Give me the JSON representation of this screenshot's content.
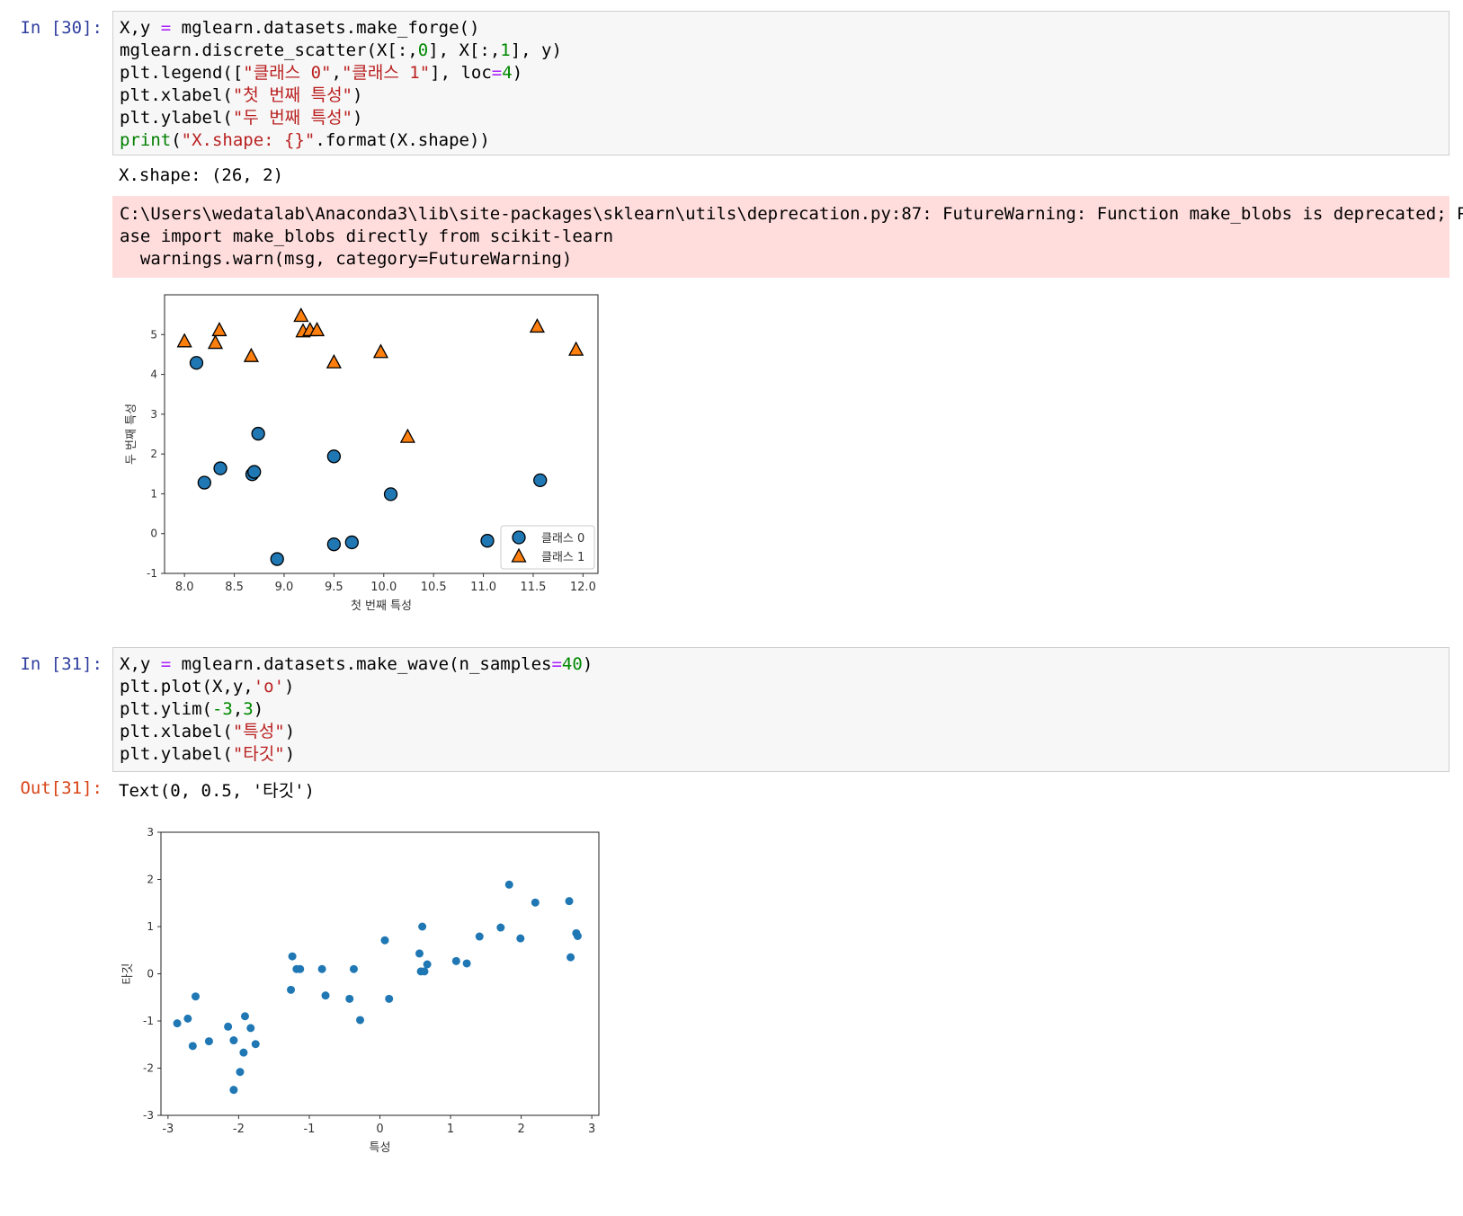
{
  "cells": [
    {
      "prompt": "In [30]:",
      "code": [
        [
          {
            "t": "X,y "
          },
          {
            "t": "=",
            "c": "op"
          },
          {
            "t": " mglearn.datasets.make_forge()"
          }
        ],
        [
          {
            "t": "mglearn.discrete_scatter(X[:,"
          },
          {
            "t": "0",
            "c": "num"
          },
          {
            "t": "], X[:,"
          },
          {
            "t": "1",
            "c": "num"
          },
          {
            "t": "], y)"
          }
        ],
        [
          {
            "t": "plt.legend(["
          },
          {
            "t": "\"클래스 0\"",
            "c": "str"
          },
          {
            "t": ","
          },
          {
            "t": "\"클래스 1\"",
            "c": "str"
          },
          {
            "t": "], loc"
          },
          {
            "t": "=",
            "c": "op"
          },
          {
            "t": "4",
            "c": "num"
          },
          {
            "t": ")"
          }
        ],
        [
          {
            "t": "plt.xlabel("
          },
          {
            "t": "\"첫 번째 특성\"",
            "c": "str"
          },
          {
            "t": ")"
          }
        ],
        [
          {
            "t": "plt.ylabel("
          },
          {
            "t": "\"두 번째 특성\"",
            "c": "str"
          },
          {
            "t": ")"
          }
        ],
        [
          {
            "t": "print",
            "c": "bi"
          },
          {
            "t": "("
          },
          {
            "t": "\"X.shape: {}\"",
            "c": "str"
          },
          {
            "t": ".format(X.shape))"
          }
        ]
      ],
      "stdout": "X.shape: (26, 2)",
      "stderr": [
        "C:\\Users\\wedatalab\\Anaconda3\\lib\\site-packages\\sklearn\\utils\\deprecation.py:87: FutureWarning: Function make_blobs is deprecated; Ple",
        "ase import make_blobs directly from scikit-learn",
        "  warnings.warn(msg, category=FutureWarning)"
      ]
    },
    {
      "prompt": "In [31]:",
      "code": [
        [
          {
            "t": "X,y "
          },
          {
            "t": "=",
            "c": "op"
          },
          {
            "t": " mglearn.datasets.make_wave(n_samples"
          },
          {
            "t": "=",
            "c": "op"
          },
          {
            "t": "40",
            "c": "num"
          },
          {
            "t": ")"
          }
        ],
        [
          {
            "t": "plt.plot(X,y,"
          },
          {
            "t": "'o'",
            "c": "str"
          },
          {
            "t": ")"
          }
        ],
        [
          {
            "t": "plt.ylim("
          },
          {
            "t": "-3",
            "c": "num"
          },
          {
            "t": ","
          },
          {
            "t": "3",
            "c": "num"
          },
          {
            "t": ")"
          }
        ],
        [
          {
            "t": "plt.xlabel("
          },
          {
            "t": "\"특성\"",
            "c": "str"
          },
          {
            "t": ")"
          }
        ],
        [
          {
            "t": "plt.ylabel("
          },
          {
            "t": "\"타깃\"",
            "c": "str"
          },
          {
            "t": ")"
          }
        ]
      ],
      "out_prompt": "Out[31]:",
      "out_text": "Text(0, 0.5, '타깃')"
    }
  ],
  "colors": {
    "class0": "#1f77b4",
    "class1": "#ff7f0e",
    "wave": "#1f77b4"
  },
  "chart_data": [
    {
      "type": "scatter",
      "xlabel": "첫 번째 특성",
      "ylabel": "두 번째 특성",
      "xlim": [
        7.8,
        12.15
      ],
      "ylim": [
        -1,
        6
      ],
      "xticks": [
        "8.0",
        "8.5",
        "9.0",
        "9.5",
        "10.0",
        "10.5",
        "11.0",
        "11.5",
        "12.0"
      ],
      "xtick_values": [
        8.0,
        8.5,
        9.0,
        9.5,
        10.0,
        10.5,
        11.0,
        11.5,
        12.0
      ],
      "yticks": [
        "-1",
        "0",
        "1",
        "2",
        "3",
        "4",
        "5"
      ],
      "ytick_values": [
        -1,
        0,
        1,
        2,
        3,
        4,
        5
      ],
      "legend_position": "lower-right",
      "series": [
        {
          "name": "클래스 0",
          "marker": "circle",
          "points": [
            [
              8.12,
              4.29
            ],
            [
              8.2,
              1.28
            ],
            [
              8.36,
              1.64
            ],
            [
              8.68,
              1.49
            ],
            [
              8.7,
              1.55
            ],
            [
              8.74,
              2.51
            ],
            [
              8.93,
              -0.64
            ],
            [
              9.5,
              1.94
            ],
            [
              9.5,
              -0.27
            ],
            [
              9.68,
              -0.22
            ],
            [
              10.07,
              0.99
            ],
            [
              11.04,
              -0.18
            ],
            [
              11.57,
              1.34
            ]
          ]
        },
        {
          "name": "클래스 1",
          "marker": "triangle",
          "points": [
            [
              8.0,
              4.83
            ],
            [
              8.31,
              4.79
            ],
            [
              8.35,
              5.11
            ],
            [
              8.67,
              4.46
            ],
            [
              9.17,
              5.47
            ],
            [
              9.19,
              5.08
            ],
            [
              9.26,
              5.11
            ],
            [
              9.33,
              5.11
            ],
            [
              9.5,
              4.3
            ],
            [
              9.97,
              4.56
            ],
            [
              10.24,
              2.43
            ],
            [
              11.54,
              5.2
            ],
            [
              11.93,
              4.62
            ]
          ]
        }
      ]
    },
    {
      "type": "scatter",
      "xlabel": "특성",
      "ylabel": "타깃",
      "xlim": [
        -3.1,
        3.1
      ],
      "ylim": [
        -3,
        3
      ],
      "xticks": [
        "-3",
        "-2",
        "-1",
        "0",
        "1",
        "2",
        "3"
      ],
      "xtick_values": [
        -3,
        -2,
        -1,
        0,
        1,
        2,
        3
      ],
      "yticks": [
        "-3",
        "-2",
        "-1",
        "0",
        "1",
        "2",
        "3"
      ],
      "ytick_values": [
        -3,
        -2,
        -1,
        0,
        1,
        2,
        3
      ],
      "series": [
        {
          "points": [
            [
              -2.87,
              -1.05
            ],
            [
              -2.72,
              -0.95
            ],
            [
              -2.65,
              -1.53
            ],
            [
              -2.61,
              -0.48
            ],
            [
              -2.42,
              -1.43
            ],
            [
              -2.15,
              -1.12
            ],
            [
              -2.07,
              -1.41
            ],
            [
              -2.07,
              -2.46
            ],
            [
              -1.98,
              -2.08
            ],
            [
              -1.93,
              -1.67
            ],
            [
              -1.91,
              -0.9
            ],
            [
              -1.83,
              -1.15
            ],
            [
              -1.76,
              -1.49
            ],
            [
              -1.26,
              -0.34
            ],
            [
              -1.24,
              0.37
            ],
            [
              -1.18,
              0.1
            ],
            [
              -1.13,
              0.1
            ],
            [
              -0.82,
              0.1
            ],
            [
              -0.77,
              -0.46
            ],
            [
              -0.43,
              -0.53
            ],
            [
              -0.37,
              0.1
            ],
            [
              -0.28,
              -0.98
            ],
            [
              0.07,
              0.71
            ],
            [
              0.13,
              -0.53
            ],
            [
              0.56,
              0.43
            ],
            [
              0.58,
              0.05
            ],
            [
              0.6,
              1.0
            ],
            [
              0.63,
              0.05
            ],
            [
              0.67,
              0.2
            ],
            [
              1.08,
              0.27
            ],
            [
              1.23,
              0.22
            ],
            [
              1.41,
              0.79
            ],
            [
              1.71,
              0.98
            ],
            [
              1.83,
              1.89
            ],
            [
              1.99,
              0.75
            ],
            [
              2.2,
              1.51
            ],
            [
              2.68,
              1.54
            ],
            [
              2.7,
              0.35
            ],
            [
              2.78,
              0.86
            ],
            [
              2.8,
              0.8
            ]
          ]
        }
      ]
    }
  ]
}
